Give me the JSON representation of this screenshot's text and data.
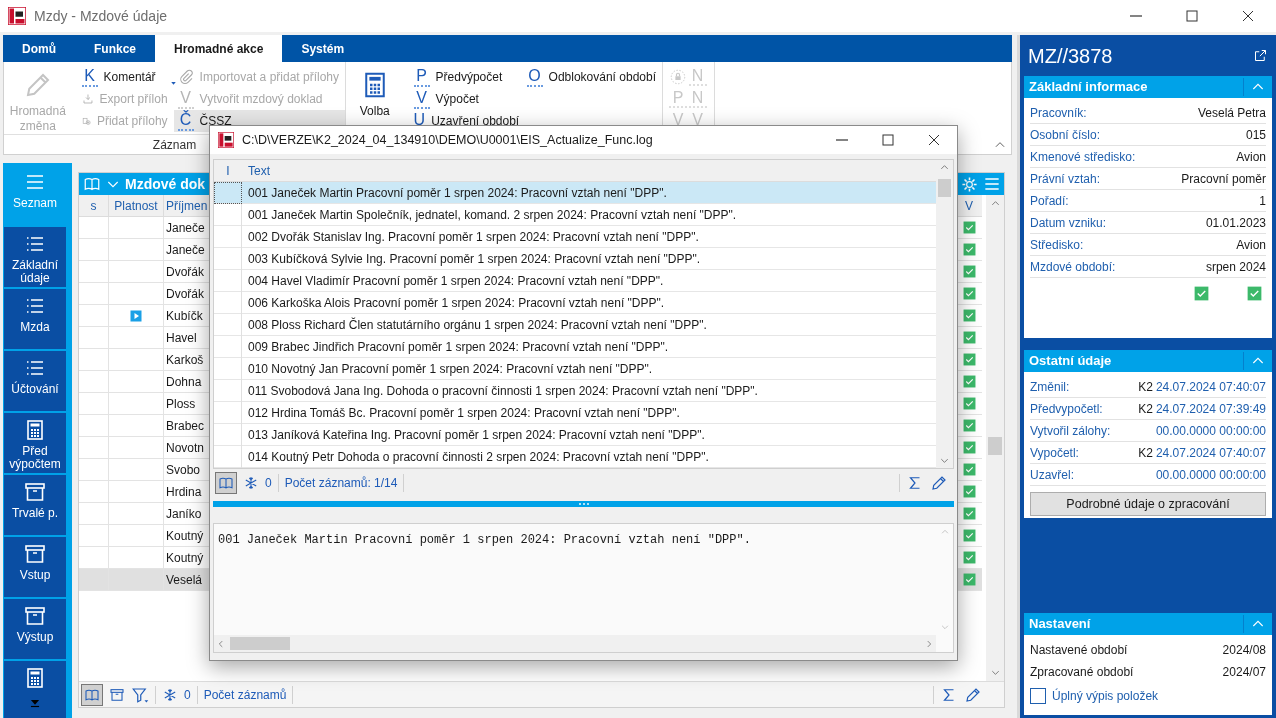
{
  "window": {
    "title": "Mzdy - Mzdové údaje"
  },
  "ribbon": {
    "tabs": [
      {
        "label": "Domů",
        "selected": false
      },
      {
        "label": "Funkce",
        "selected": false
      },
      {
        "label": "Hromadné akce",
        "selected": true
      },
      {
        "label": "Systém",
        "selected": false
      }
    ],
    "groups": [
      {
        "label": "Záznam",
        "big": {
          "kind": "pencil",
          "label": "Hromadná změna",
          "disabled": true
        },
        "columns": [
          {
            "commands": [
              {
                "kind": "letter",
                "key": "K",
                "label": "Komentář",
                "disabled": false,
                "hovered": false,
                "dropdown": true
              },
              {
                "kind": "download",
                "label": "Export příloh",
                "disabled": true,
                "hovered": false,
                "dropdown": false
              },
              {
                "kind": "attach",
                "label": "Přidat přílohy",
                "disabled": true,
                "hovered": false,
                "dropdown": false
              }
            ]
          },
          {
            "commands": [
              {
                "kind": "paperclip",
                "label": "Importovat a přidat přílohy",
                "disabled": true,
                "hovered": false,
                "dropdown": false
              },
              {
                "kind": "letter",
                "key": "V",
                "label": "Vytvořit mzdový doklad",
                "disabled": true,
                "hovered": false,
                "dropdown": false
              },
              {
                "kind": "letter",
                "key": "Č",
                "label": "ČSSZ",
                "disabled": false,
                "hovered": true,
                "dropdown": false
              }
            ]
          }
        ]
      },
      {
        "big": {
          "kind": "calculator",
          "label": "Volba",
          "disabled": false
        },
        "columns": [
          {
            "commands": [
              {
                "kind": "letter",
                "key": "P",
                "label": "Předvýpočet",
                "disabled": false,
                "hovered": false,
                "dropdown": false
              },
              {
                "kind": "letter",
                "key": "V",
                "label": "Výpočet",
                "disabled": false,
                "hovered": false,
                "dropdown": false
              },
              {
                "kind": "letter",
                "key": "U",
                "label": "Uzavření období",
                "disabled": false,
                "hovered": false
              }
            ]
          },
          {
            "commands": [
              {
                "kind": "letter",
                "key": "O",
                "label": "Odblokování období",
                "disabled": false,
                "hovered": false,
                "dropdown": false
              }
            ]
          }
        ],
        "mini": [
          {
            "kind": "lock",
            "disabled": true
          },
          {
            "kind": "letter",
            "key": "N",
            "disabled": true
          },
          {
            "kind": "letter",
            "key": "P",
            "disabled": true
          },
          {
            "kind": "letter",
            "key": "N",
            "disabled": true
          },
          {
            "kind": "letter",
            "key": "V",
            "disabled": true
          },
          {
            "kind": "letter",
            "key": "V",
            "disabled": true
          }
        ]
      }
    ]
  },
  "nav": [
    {
      "kind": "lines",
      "label": "Seznam",
      "selected": true
    },
    {
      "kind": "list",
      "label": "Základní údaje",
      "selected": false
    },
    {
      "kind": "list",
      "label": "Mzda",
      "selected": false
    },
    {
      "kind": "list",
      "label": "Účtování",
      "selected": false
    },
    {
      "kind": "calculator",
      "label": "Před výpočtem",
      "selected": false
    },
    {
      "kind": "box",
      "label": "Trvalé p.",
      "selected": false
    },
    {
      "kind": "box",
      "label": "Vstup",
      "selected": false
    },
    {
      "kind": "box",
      "label": "Výstup",
      "selected": false
    },
    {
      "kind": "calculator",
      "selected": false
    }
  ],
  "grid": {
    "title": "Mzdové dok",
    "columns": [
      "s",
      "Platnost",
      "Příjmen",
      "V"
    ],
    "rows": [
      {
        "surname": "Janeče",
        "pointer": false,
        "checked": true,
        "selected": false
      },
      {
        "surname": "Janeče",
        "pointer": false,
        "checked": true,
        "selected": false
      },
      {
        "surname": "Dvořák",
        "pointer": false,
        "checked": true,
        "selected": false
      },
      {
        "surname": "Dvořák",
        "pointer": false,
        "checked": true,
        "selected": false
      },
      {
        "surname": "Kubíčk",
        "pointer": true,
        "checked": true,
        "selected": false
      },
      {
        "surname": "Havel",
        "pointer": false,
        "checked": true,
        "selected": false
      },
      {
        "surname": "Karkoš",
        "pointer": false,
        "checked": true,
        "selected": false
      },
      {
        "surname": "Dohna",
        "pointer": false,
        "checked": true,
        "selected": false
      },
      {
        "surname": "Ploss",
        "pointer": false,
        "checked": true,
        "selected": false
      },
      {
        "surname": "Brabec",
        "pointer": false,
        "checked": true,
        "selected": false
      },
      {
        "surname": "Novotn",
        "pointer": false,
        "checked": true,
        "selected": false
      },
      {
        "surname": "Svobo",
        "pointer": false,
        "checked": true,
        "selected": false
      },
      {
        "surname": "Hrdina",
        "pointer": false,
        "checked": true,
        "selected": false
      },
      {
        "surname": "Janíko",
        "pointer": false,
        "checked": true,
        "selected": false
      },
      {
        "surname": "Koutný",
        "pointer": false,
        "checked": true,
        "selected": false
      },
      {
        "surname": "Koutný",
        "pointer": false,
        "checked": true,
        "selected": false
      },
      {
        "surname": "Veselá",
        "pointer": false,
        "checked": true,
        "selected": true
      }
    ],
    "status": {
      "count": "0",
      "records": "Počet záznamů"
    }
  },
  "dialog": {
    "title": "C:\\D\\VERZE\\K2_2024_04_134910\\DEMO\\U0001\\EIS_Actualize_Func.log",
    "columns": [
      "I",
      "Text"
    ],
    "rows": [
      {
        "text": "001 Janeček Martin Pracovní poměr 1 srpen 2024: Pracovní vztah není \"DPP\".",
        "selected": true
      },
      {
        "text": "001 Janeček Martin Společník, jednatel, komand. 2 srpen 2024: Pracovní vztah není \"DPP\".",
        "selected": false
      },
      {
        "text": "002 Dvořák Stanislav Ing. Pracovní poměr 1 srpen 2024: Pracovní vztah není \"DPP\".",
        "selected": false
      },
      {
        "text": "003 Kubíčková Sylvie Ing. Pracovní poměr 1 srpen 2024: Pracovní vztah není \"DPP\".",
        "selected": false
      },
      {
        "text": "004 Havel Vladimír Pracovní poměr 1 srpen 2024: Pracovní vztah není \"DPP\".",
        "selected": false
      },
      {
        "text": "006 Karkoška Alois Pracovní poměr 1 srpen 2024: Pracovní vztah není \"DPP\".",
        "selected": false
      },
      {
        "text": "008 Ploss Richard Člen statutárního orgánu 1 srpen 2024: Pracovní vztah není \"DPP\".",
        "selected": false
      },
      {
        "text": "009 Brabec Jindřich Pracovní poměr 1 srpen 2024: Pracovní vztah není \"DPP\".",
        "selected": false
      },
      {
        "text": "010 Novotný Jan Pracovní poměr 1 srpen 2024: Pracovní vztah není \"DPP\".",
        "selected": false
      },
      {
        "text": "011 Svobodová Jana Ing. Dohoda o pracovní činnosti 1 srpen 2024: Pracovní vztah není \"DPP\".",
        "selected": false
      },
      {
        "text": "012 Hrdina Tomáš Bc. Pracovní poměr 1 srpen 2024: Pracovní vztah není \"DPP\".",
        "selected": false
      },
      {
        "text": "013 Janíková Kateřina Ing. Pracovní poměr 1 srpen 2024: Pracovní vztah není \"DPP\".",
        "selected": false
      },
      {
        "text": "014 Koutný Petr Dohoda o pracovní činnosti 2 srpen 2024: Pracovní vztah není \"DPP\".",
        "selected": false
      }
    ],
    "status": {
      "count": "0",
      "records": "Počet záznamů: 1/14"
    },
    "detail": "001 Janeček Martin Pracovní poměr 1 srpen 2024: Pracovní vztah není \"DPP\"."
  },
  "panel": {
    "title": "MZ//3878",
    "sections": [
      {
        "kind": "fields",
        "title": "Základní informace",
        "expanded": true,
        "rows": [
          {
            "label": "Pracovník:",
            "value": "Veselá Petra"
          },
          {
            "label": "Osobní číslo:",
            "value": "015"
          },
          {
            "label": "Kmenové středisko:",
            "value": "Avion"
          },
          {
            "label": "Právní vztah:",
            "value": "Pracovní poměr"
          },
          {
            "label": "Pořadí:",
            "value": "1"
          },
          {
            "label": "Datum vzniku:",
            "value": "01.01.2023"
          },
          {
            "label": "Středisko:",
            "value": "Avion"
          },
          {
            "label": "Mzdové období:",
            "value": "srpen 2024"
          }
        ],
        "checks": [
          {
            "checked": true
          },
          {
            "checked": true
          }
        ]
      },
      {
        "kind": "fields",
        "title": "Ostatní údaje",
        "expanded": true,
        "rows": [
          {
            "label": "Změnil:",
            "user": "K2",
            "value": "24.07.2024 07:40:07"
          },
          {
            "label": "Předvypočetl:",
            "user": "K2",
            "value": "24.07.2024 07:39:49"
          },
          {
            "label": "Vytvořil zálohy:",
            "value": "00.00.0000 00:00:00"
          },
          {
            "label": "Vypočetl:",
            "user": "K2",
            "value": "24.07.2024 07:40:07"
          },
          {
            "label": "Uzavřel:",
            "value": "00.00.0000 00:00:00"
          }
        ],
        "button": "Podrobné údaje o zpracování"
      },
      {
        "kind": "settings",
        "title": "Nastavení",
        "expanded": true,
        "rows": [
          {
            "label": "Nastavené období",
            "value": "2024/08"
          },
          {
            "label": "Zpracované období",
            "value": "2024/07"
          }
        ],
        "checkbox": {
          "label": "Úplný výpis položek",
          "checked": false
        }
      }
    ]
  }
}
